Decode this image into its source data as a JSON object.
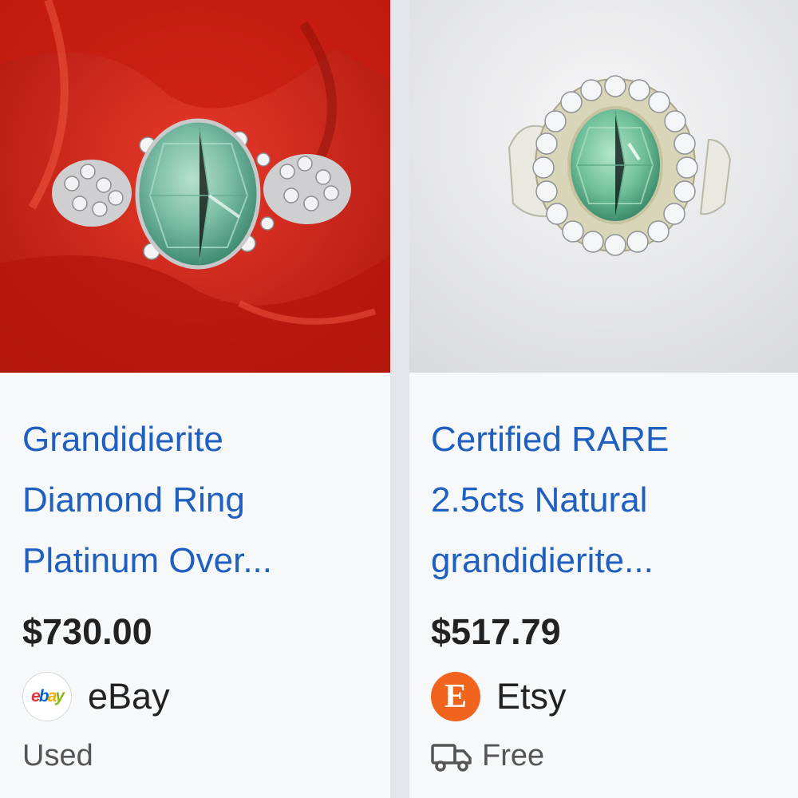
{
  "results": [
    {
      "title_lines": [
        "Grandidierite",
        "Diamond Ring",
        "Platinum Over..."
      ],
      "price": "$730.00",
      "seller": {
        "name": "eBay",
        "logo_text": "ebay",
        "icon": "ebay-logo-icon"
      },
      "condition": "Used",
      "image": {
        "background": "#d8251a",
        "gem_color": "#7fbfa8"
      }
    },
    {
      "title_lines": [
        "Certified RARE",
        "2.5cts Natural",
        "grandidierite..."
      ],
      "price": "$517.79",
      "seller": {
        "name": "Etsy",
        "logo_text": "E",
        "icon": "etsy-logo-icon"
      },
      "shipping": {
        "label": "Free",
        "icon": "truck-icon"
      },
      "image": {
        "background": "#e8e9ea",
        "gem_color": "#6fbf9a"
      }
    }
  ],
  "colors": {
    "link": "#1f5fbf",
    "price": "#222222",
    "muted": "#555555",
    "etsy_orange": "#f1641e"
  }
}
